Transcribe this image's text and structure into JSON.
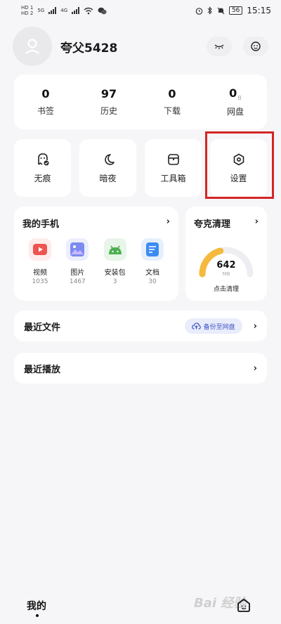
{
  "status_bar": {
    "sim1": "HD 1",
    "sim2": "HD 2",
    "net1": "5G",
    "net2": "4G",
    "battery": "56",
    "time": "15:15"
  },
  "profile": {
    "username": "夸父5428"
  },
  "stats": [
    {
      "value": "0",
      "label": "书签"
    },
    {
      "value": "97",
      "label": "历史"
    },
    {
      "value": "0",
      "label": "下载"
    },
    {
      "value": "0",
      "unit": "B",
      "label": "网盘"
    }
  ],
  "tools": [
    {
      "label": "无痕",
      "icon": "ghost-icon"
    },
    {
      "label": "暗夜",
      "icon": "moon-icon"
    },
    {
      "label": "工具箱",
      "icon": "toolbox-icon"
    },
    {
      "label": "设置",
      "icon": "settings-hexagon-icon"
    }
  ],
  "my_phone": {
    "title": "我的手机",
    "items": [
      {
        "name": "视频",
        "count": "1035",
        "icon": "video-icon",
        "color": "#ef5350"
      },
      {
        "name": "图片",
        "count": "1467",
        "icon": "image-icon",
        "color": "#6f7fe8"
      },
      {
        "name": "安装包",
        "count": "3",
        "icon": "android-icon",
        "color": "#4caf50"
      },
      {
        "name": "文档",
        "count": "30",
        "icon": "document-icon",
        "color": "#3d8bf2"
      }
    ]
  },
  "cleaner": {
    "title": "夸克清理",
    "value": "642",
    "unit": "MB",
    "action": "点击清理",
    "fill_fraction": 0.42,
    "gauge_color": "#f5b93b"
  },
  "recent_files": {
    "title": "最近文件",
    "backup_label": "备份至网盘"
  },
  "recent_play": {
    "title": "最近播放"
  },
  "tabbar": {
    "mine_label": "我的"
  },
  "watermark": "Bai 经验"
}
